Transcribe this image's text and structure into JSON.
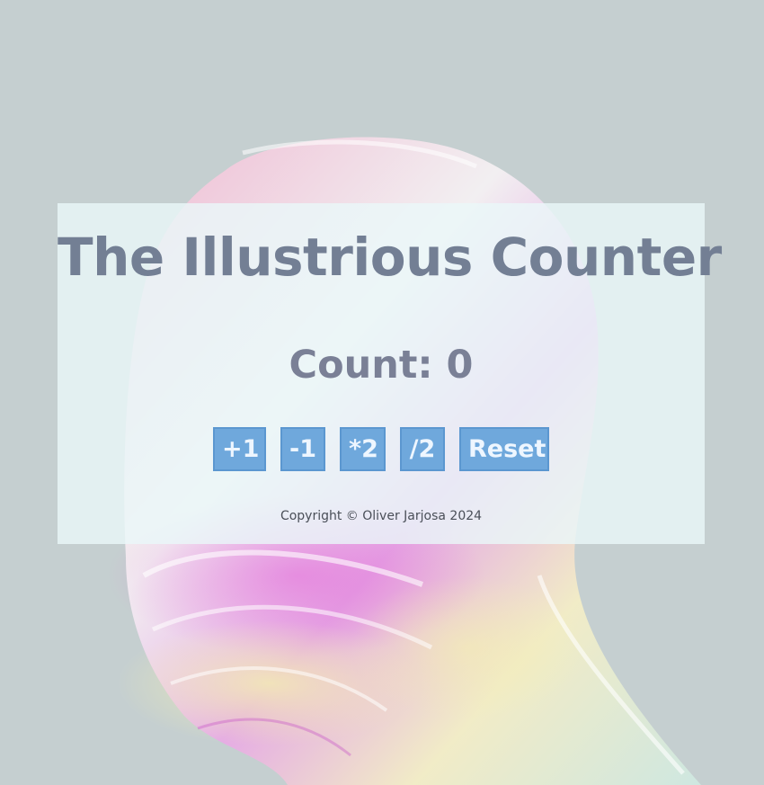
{
  "app": {
    "title": "The Illustrious Counter"
  },
  "counter": {
    "label": "Count: 0"
  },
  "buttons": {
    "increment": "+1",
    "decrement": "-1",
    "double": "*2",
    "halve": "/2",
    "reset": "Reset"
  },
  "footer": {
    "copyright": "Copyright © Oliver Jarjosa 2024"
  },
  "colors": {
    "background": "#c5cfd0",
    "card": "#eaf8f9",
    "title": "#737f94",
    "button": "#6fa8dc",
    "button_text": "#eef6ff"
  }
}
